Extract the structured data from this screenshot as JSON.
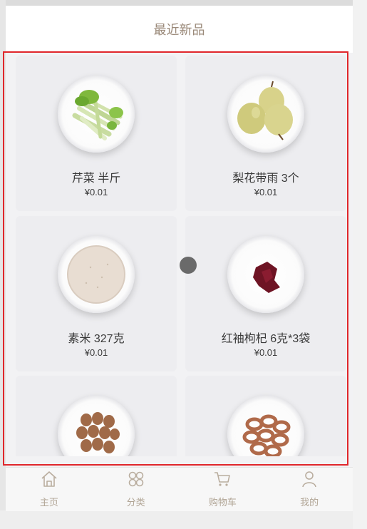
{
  "section": {
    "title": "最近新品"
  },
  "products": [
    {
      "name": "芹菜 半斤",
      "price": "¥0.01",
      "image": "celery"
    },
    {
      "name": "梨花带雨 3个",
      "price": "¥0.01",
      "image": "pears"
    },
    {
      "name": "素米 327克",
      "price": "¥0.01",
      "image": "rice"
    },
    {
      "name": "红袖枸杞 6克*3袋",
      "price": "¥0.01",
      "image": "goji"
    },
    {
      "name": "",
      "price": "",
      "image": "eggs"
    },
    {
      "name": "",
      "price": "",
      "image": "onion-rings"
    }
  ],
  "tabs": [
    {
      "label": "主页",
      "icon": "home-icon"
    },
    {
      "label": "分类",
      "icon": "category-icon"
    },
    {
      "label": "购物车",
      "icon": "cart-icon"
    },
    {
      "label": "我的",
      "icon": "user-icon"
    }
  ],
  "colors": {
    "accent": "#9b8a7a",
    "highlight": "#e0262b",
    "tab_text": "#b0a494"
  }
}
